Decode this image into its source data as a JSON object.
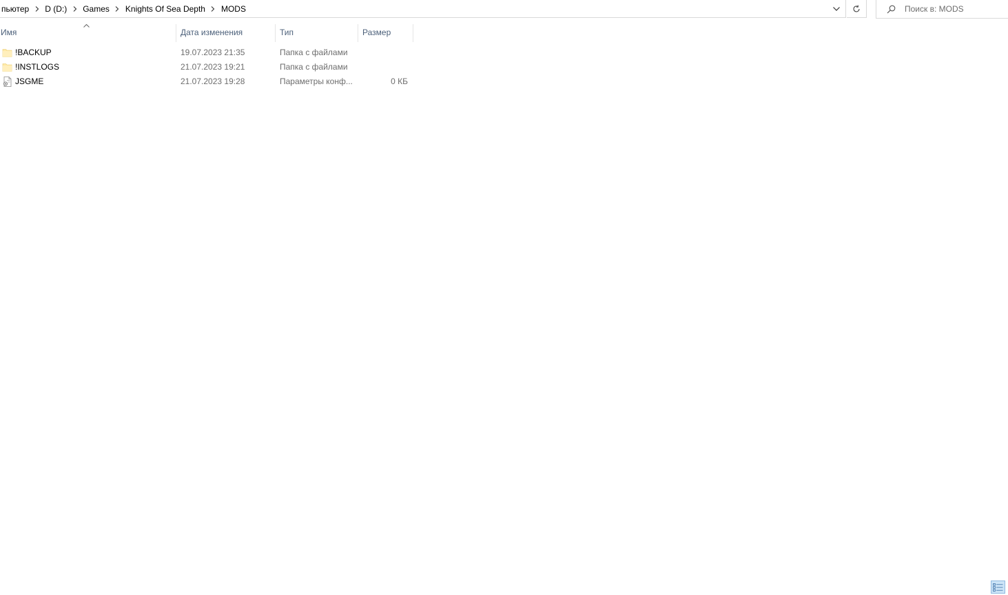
{
  "address": {
    "breadcrumb": [
      "пьютер",
      "D (D:)",
      "Games",
      "Knights Of Sea Depth",
      "MODS"
    ]
  },
  "search": {
    "placeholder": "Поиск в: MODS"
  },
  "columns": {
    "name": "Имя",
    "date": "Дата изменения",
    "type": "Тип",
    "size": "Размер"
  },
  "files": [
    {
      "name": "!BACKUP",
      "date": "19.07.2023 21:35",
      "type": "Папка с файлами",
      "size": "",
      "icon": "folder-icon"
    },
    {
      "name": "!INSTLOGS",
      "date": "21.07.2023 19:21",
      "type": "Папка с файлами",
      "size": "",
      "icon": "folder-icon"
    },
    {
      "name": "JSGME",
      "date": "21.07.2023 19:28",
      "type": "Параметры конф...",
      "size": "0 КБ",
      "icon": "config-file-icon"
    }
  ],
  "colors": {
    "header_text": "#4c607a",
    "secondary_text": "#6d6d6d",
    "folder": "#ffe9a6",
    "view_toggle_active": "#cce4f7"
  }
}
